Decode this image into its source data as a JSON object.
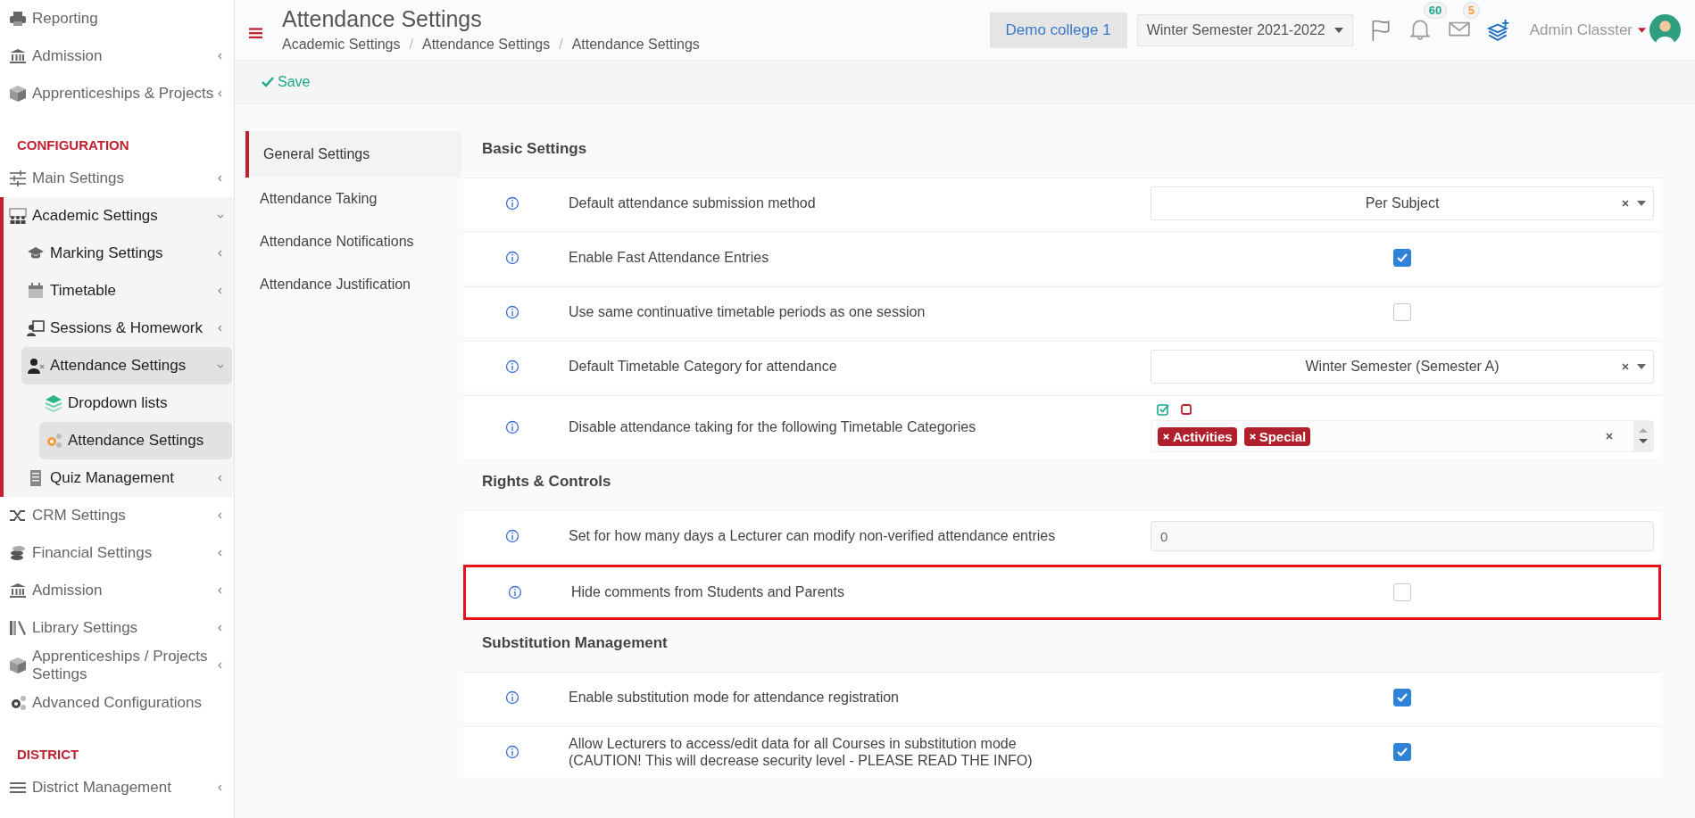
{
  "sidebar": {
    "items": [
      {
        "kind": "item",
        "label": "Reporting",
        "selected": false
      },
      {
        "kind": "item",
        "label": "Admission",
        "selected": false,
        "expanded": false
      },
      {
        "kind": "item",
        "label": "Apprenticeships & Projects",
        "selected": false,
        "expanded": false
      },
      {
        "kind": "heading",
        "label": "CONFIGURATION"
      },
      {
        "kind": "item",
        "label": "Main Settings",
        "selected": false,
        "expanded": false
      },
      {
        "kind": "item",
        "label": "Academic Settings",
        "selected": false,
        "expanded": true,
        "children": [
          {
            "kind": "item",
            "label": "Marking Settings",
            "selected": false,
            "expanded": false
          },
          {
            "kind": "item",
            "label": "Timetable",
            "selected": false,
            "expanded": false
          },
          {
            "kind": "item",
            "label": "Sessions & Homework",
            "selected": false,
            "expanded": false
          },
          {
            "kind": "item",
            "label": "Attendance Settings",
            "selected": true,
            "expanded": true,
            "children": [
              {
                "kind": "item",
                "label": "Dropdown lists",
                "selected": false
              },
              {
                "kind": "item",
                "label": "Attendance Settings",
                "selected": true
              }
            ]
          },
          {
            "kind": "item",
            "label": "Quiz Management",
            "selected": false,
            "expanded": false
          }
        ]
      },
      {
        "kind": "item",
        "label": "CRM Settings",
        "selected": false,
        "expanded": false
      },
      {
        "kind": "item",
        "label": "Financial Settings",
        "selected": false,
        "expanded": false
      },
      {
        "kind": "item",
        "label": "Admission",
        "selected": false,
        "expanded": false
      },
      {
        "kind": "item",
        "label": "Library Settings",
        "selected": false,
        "expanded": false
      },
      {
        "kind": "item",
        "label": "Apprenticeships / Projects Settings",
        "selected": false,
        "expanded": false
      },
      {
        "kind": "item",
        "label": "Advanced Configurations",
        "selected": false
      },
      {
        "kind": "heading",
        "label": "DISTRICT"
      },
      {
        "kind": "item",
        "label": "District Management",
        "selected": false,
        "expanded": false
      }
    ]
  },
  "header": {
    "title": "Attendance Settings",
    "breadcrumbs": [
      "Academic Settings",
      "Attendance Settings",
      "Attendance Settings"
    ],
    "breadcrumb_separator": "/",
    "college": "Demo college 1",
    "semester": "Winter Semester 2021-2022",
    "notifications_count": "60",
    "messages_count": "5",
    "user": "Admin Classter"
  },
  "toolbar": {
    "save": "Save"
  },
  "tabs": [
    {
      "label": "General Settings",
      "selected": true
    },
    {
      "label": "Attendance Taking",
      "selected": false
    },
    {
      "label": "Attendance Notifications",
      "selected": false
    },
    {
      "label": "Attendance Justification",
      "selected": false
    }
  ],
  "sections": [
    {
      "title": "Basic Settings",
      "rows": [
        {
          "kind": "select",
          "label": "Default attendance submission method",
          "value": "Per Subject",
          "highlighted": false
        },
        {
          "kind": "checkbox",
          "label": "Enable Fast Attendance Entries",
          "checked": true,
          "highlighted": false
        },
        {
          "kind": "checkbox",
          "label": "Use same continuative timetable periods as one session",
          "checked": false,
          "highlighted": false
        },
        {
          "kind": "select",
          "label": "Default Timetable Category for attendance",
          "value": "Winter Semester (Semester A)",
          "highlighted": false
        },
        {
          "kind": "multiselect",
          "label": "Disable attendance taking for the following Timetable Categories",
          "tags": [
            "Activities",
            "Special"
          ],
          "highlighted": false
        }
      ]
    },
    {
      "title": "Rights & Controls",
      "rows": [
        {
          "kind": "number",
          "label": "Set for how many days a Lecturer can modify non-verified attendance entries",
          "value": "0",
          "highlighted": false
        },
        {
          "kind": "checkbox",
          "label": "Hide comments from Students and Parents",
          "checked": false,
          "highlighted": true
        }
      ]
    },
    {
      "title": "Substitution Management",
      "rows": [
        {
          "kind": "checkbox",
          "label": "Enable substitution mode for attendance registration",
          "checked": true,
          "highlighted": false
        },
        {
          "kind": "checkbox",
          "label": "Allow Lecturers to access/edit data for all Courses in substitution mode\n(CAUTION! This will decrease security level - PLEASE READ THE INFO)",
          "checked": true,
          "highlighted": false
        }
      ]
    }
  ]
}
